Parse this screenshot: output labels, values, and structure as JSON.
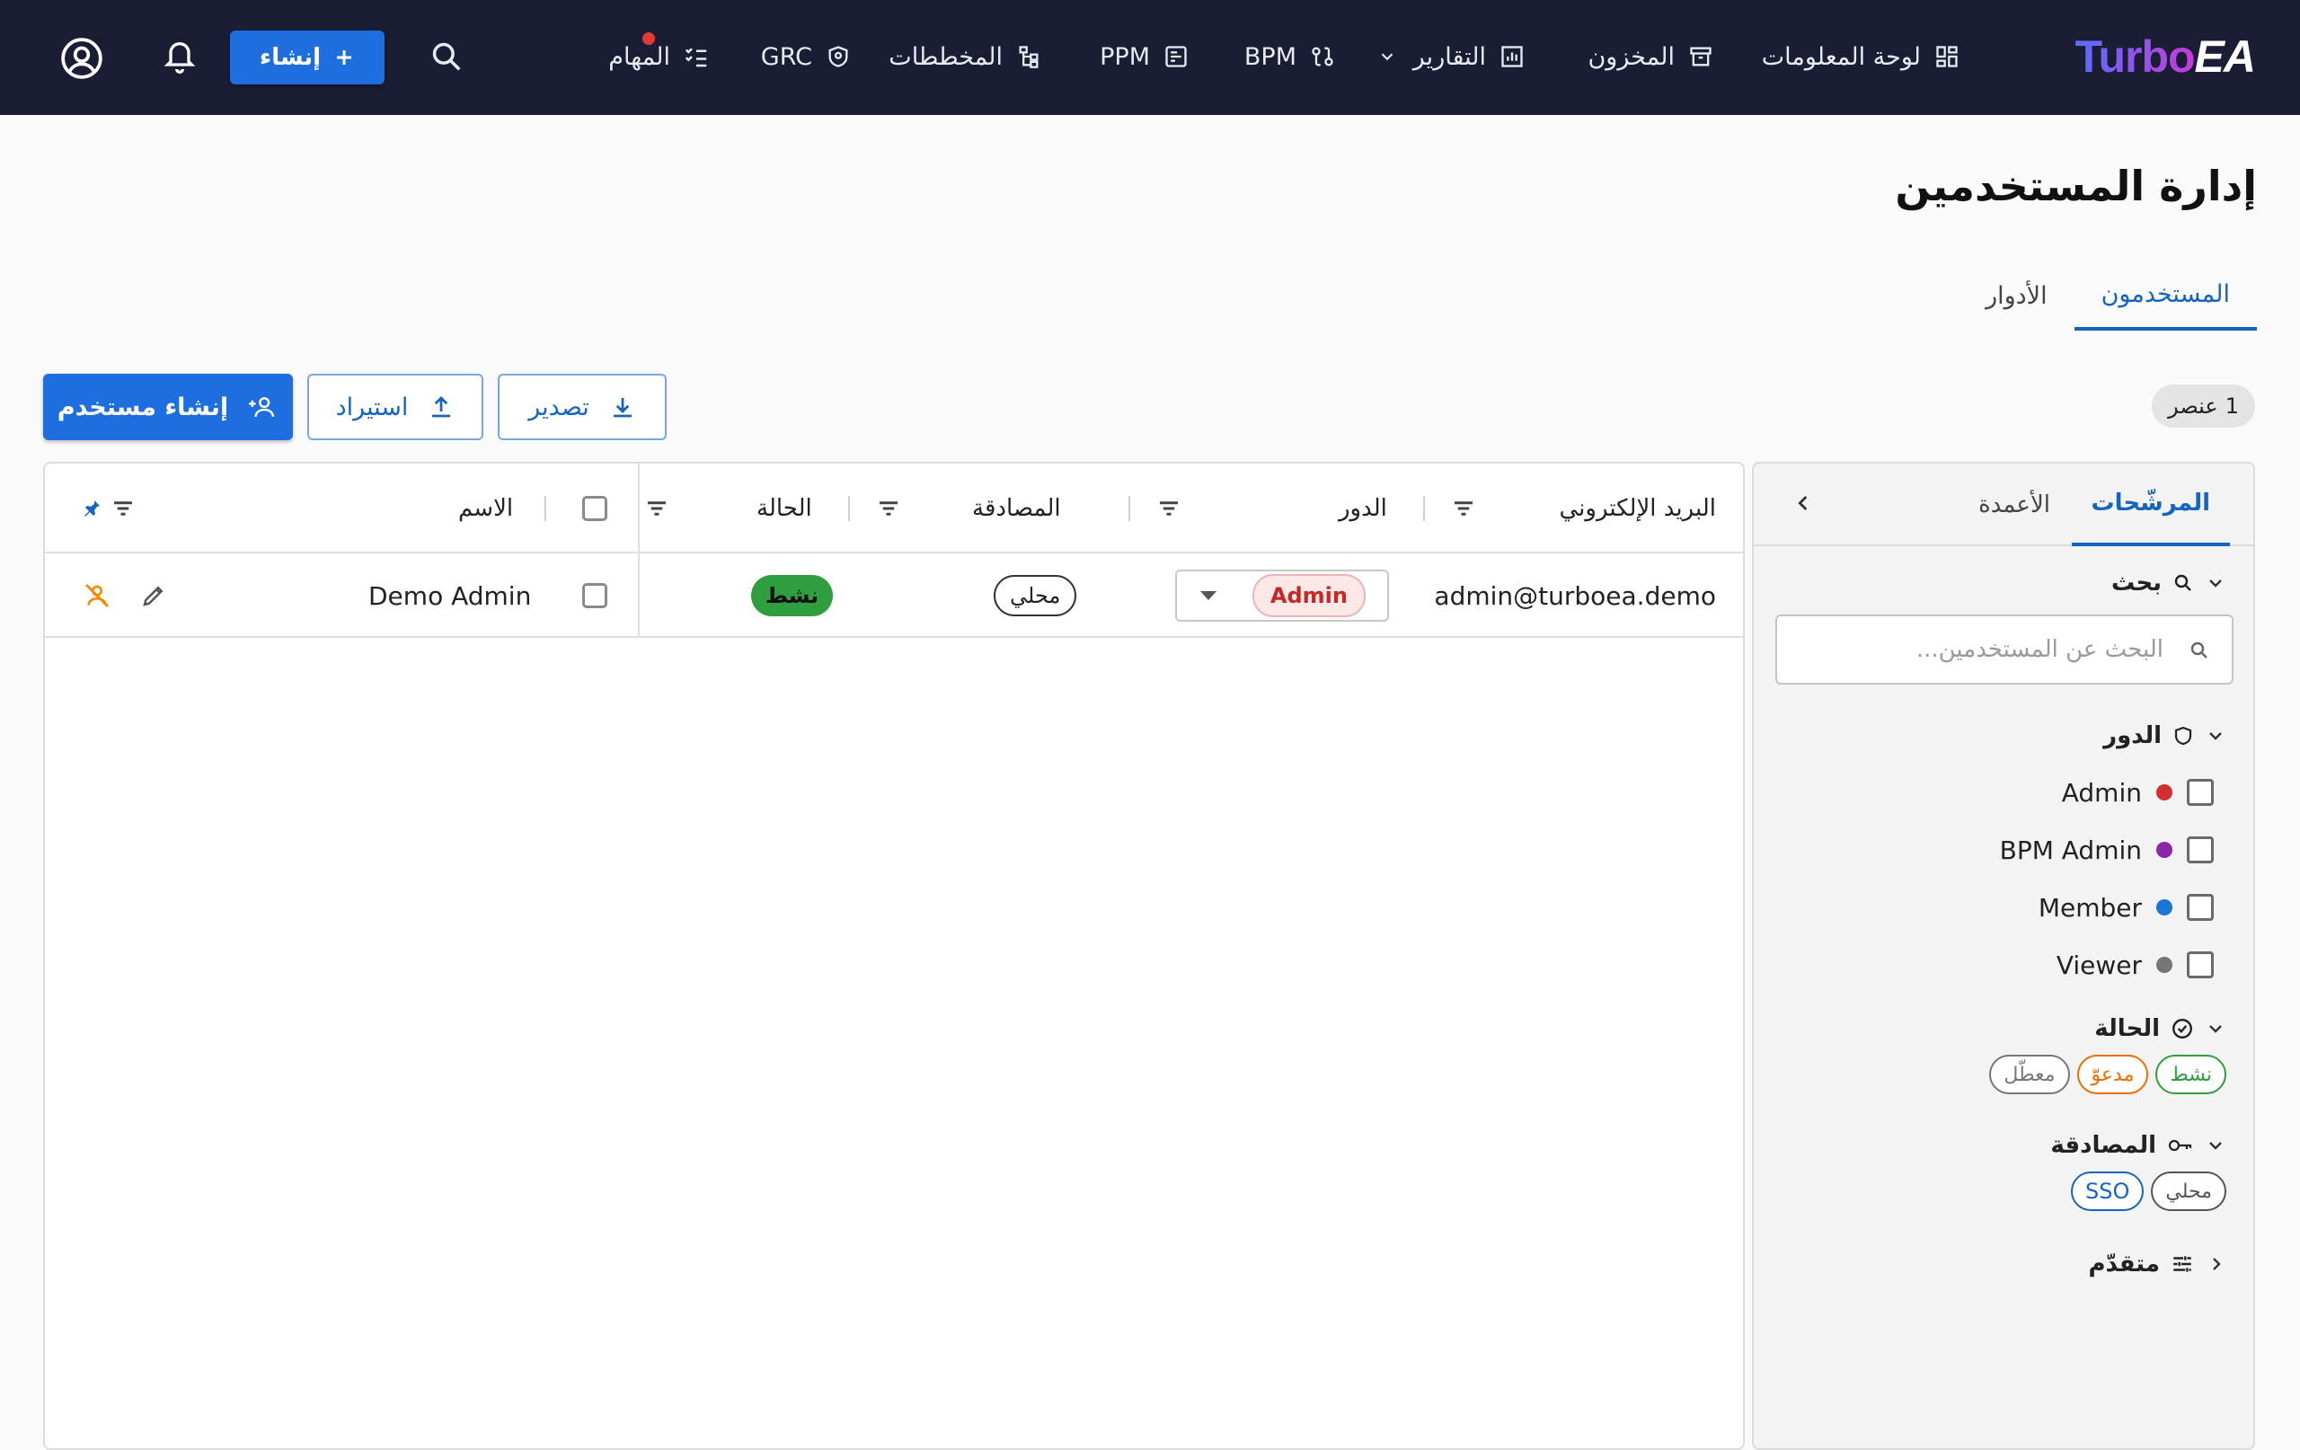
{
  "topbar": {
    "logo": {
      "part1": "Turbo",
      "part2": "EA"
    },
    "nav": [
      {
        "key": "dashboard",
        "label": "لوحة المعلومات",
        "icon": "dashboard-icon"
      },
      {
        "key": "inventory",
        "label": "المخزون",
        "icon": "archive-icon"
      },
      {
        "key": "reports",
        "label": "التقارير",
        "icon": "chart-icon",
        "has_dropdown": true
      },
      {
        "key": "bpm",
        "label": "BPM",
        "icon": "process-icon"
      },
      {
        "key": "ppm",
        "label": "PPM",
        "icon": "board-icon"
      },
      {
        "key": "diagrams",
        "label": "المخططات",
        "icon": "diagram-icon"
      },
      {
        "key": "grc",
        "label": "GRC",
        "icon": "shield-icon"
      },
      {
        "key": "tasks",
        "label": "المهام",
        "icon": "checklist-icon",
        "has_notification_dot": true
      }
    ],
    "create_label": "إنشاء"
  },
  "page": {
    "title": "إدارة المستخدمين",
    "tabs": [
      {
        "label": "المستخدمون",
        "active": true
      },
      {
        "label": "الأدوار",
        "active": false
      }
    ]
  },
  "actions": {
    "count": "1",
    "count_label": "عنصر",
    "create_user_label": "إنشاء مستخدم",
    "import_label": "استيراد",
    "export_label": "تصدير"
  },
  "table": {
    "columns": {
      "email": "البريد الإلكتروني",
      "role": "الدور",
      "auth": "المصادقة",
      "status": "الحالة",
      "name": "الاسم"
    },
    "rows": [
      {
        "email": "admin@turboea.demo",
        "role": "Admin",
        "auth": "محلي",
        "status": "نشط",
        "name": "Demo Admin"
      }
    ]
  },
  "filters": {
    "tabs": {
      "filters": "المرشّحات",
      "columns": "الأعمدة"
    },
    "search": {
      "title": "بحث",
      "placeholder": "البحث عن المستخدمين..."
    },
    "role": {
      "title": "الدور",
      "options": [
        {
          "label": "Admin",
          "color": "#d32f2f"
        },
        {
          "label": "BPM Admin",
          "color": "#8e24aa"
        },
        {
          "label": "Member",
          "color": "#1976d2"
        },
        {
          "label": "Viewer",
          "color": "#757575"
        }
      ]
    },
    "status": {
      "title": "الحالة",
      "chips": [
        {
          "label": "نشط",
          "color": "#2e9e3e"
        },
        {
          "label": "مدعوّ",
          "color": "#ef6c00"
        },
        {
          "label": "معطّل",
          "color": "#777777"
        }
      ]
    },
    "auth": {
      "title": "المصادقة",
      "chips": [
        {
          "label": "محلي",
          "color": "#555555"
        },
        {
          "label": "SSO",
          "color": "#1565c0"
        }
      ]
    },
    "advanced": {
      "title": "متقدّم"
    }
  }
}
